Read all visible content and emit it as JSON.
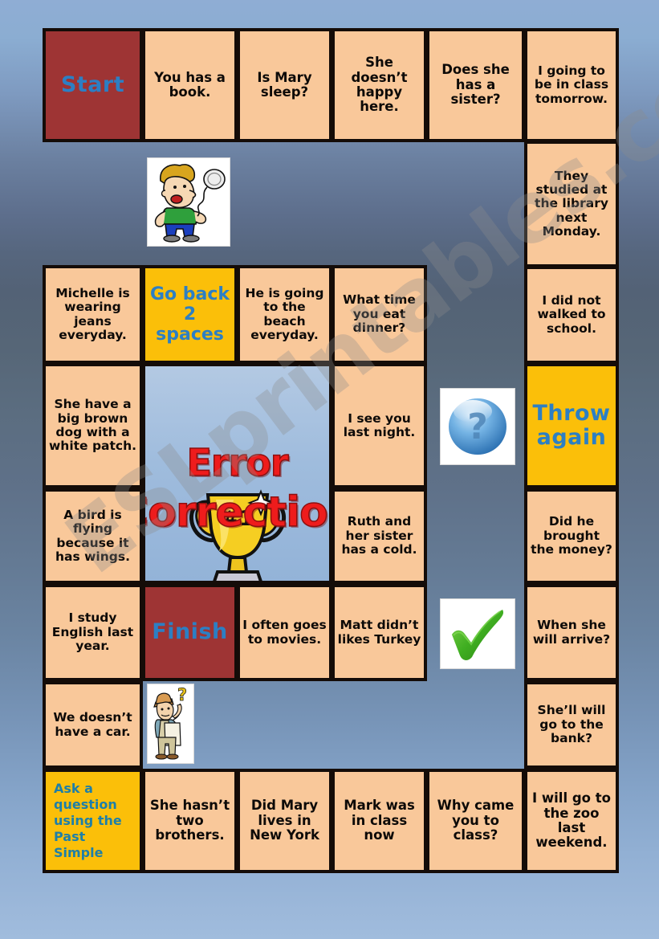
{
  "document": {
    "title": "Error Correction",
    "type": "board-game-worksheet",
    "watermark": "ESLprintables.com"
  },
  "board": {
    "center_tile": {
      "line1": "Error",
      "line2": "Correction",
      "icon": "trophy-icon"
    },
    "colors": {
      "tile": "#F9C89A",
      "special_red": "#9E3434",
      "special_gold": "#FBBF09",
      "center_bg": "#9FBCDD",
      "border": "#140C08",
      "blue_text": "#2C7FC4",
      "title_red": "#EE1C1C"
    },
    "tiles": {
      "start": "Start",
      "finish": "Finish",
      "go_back": "Go back\n2 spaces",
      "go_back_l1": "Go back",
      "go_back_l2": "2 spaces",
      "throw_again_l1": "Throw",
      "throw_again_l2": "again",
      "ask_question": "Ask a question using the Past Simple",
      "r1c2": "You has a book.",
      "r1c3": "Is Mary sleep?",
      "r1c4": "She doesn’t happy here.",
      "r1c5": "Does she has a sister?",
      "r1c6": "I going to be in class tomorrow.",
      "r2c6": "They studied at the library next Monday.",
      "r3c1": "Michelle is wearing jeans everyday.",
      "r3c3": "He is going to the beach everyday.",
      "r3c4": "What time you eat dinner?",
      "r3c6": "I did not walked to school.",
      "r4c1": "She have a big brown dog with a white patch.",
      "r4c4": "I see you last night.",
      "r5c1": "A bird is flying because it has wings.",
      "r5c4": "Ruth and her sister has a cold.",
      "r5c6": "Did he brought the money?",
      "r6c1": "I study English last year.",
      "r6c3": "I often goes to movies.",
      "r6c4": "Matt didn’t likes Turkey",
      "r6c6": "When she will arrive?",
      "r7c1": "We doesn’t have a car.",
      "r7c6": "She’ll will go to the bank?",
      "r8c2": "She hasn’t two brothers.",
      "r8c3": "Did Mary lives in New York",
      "r8c4": "Mark was in class now",
      "r8c5": "Why came you to class?",
      "r8c6": "I will go to the zoo last weekend."
    }
  },
  "clipart": {
    "boy_coin": "boy-flipping-coin-image",
    "question_orb": "blue-question-mark-orb-icon",
    "check_mark": "green-check-mark-icon",
    "man_thinking": "man-with-question-mark-image"
  }
}
